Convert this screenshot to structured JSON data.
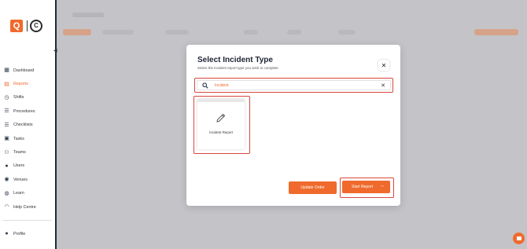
{
  "sidebar": {
    "items": [
      {
        "label": "Dashboard",
        "icon": "dashboard-icon",
        "glyph": "▦"
      },
      {
        "label": "Reports",
        "icon": "reports-icon",
        "glyph": "▤",
        "active": true
      },
      {
        "label": "Shifts",
        "icon": "clock-icon",
        "glyph": "◷"
      },
      {
        "label": "Procedures",
        "icon": "list-icon",
        "glyph": "☰"
      },
      {
        "label": "Checklists",
        "icon": "checklist-icon",
        "glyph": "☰"
      },
      {
        "label": "Tasks",
        "icon": "tasks-icon",
        "glyph": "▣"
      },
      {
        "label": "Teams",
        "icon": "teams-icon",
        "glyph": "⚇"
      },
      {
        "label": "Users",
        "icon": "user-icon",
        "glyph": "●"
      },
      {
        "label": "Venues",
        "icon": "location-pin-icon",
        "glyph": "◉"
      },
      {
        "label": "Learn",
        "icon": "lightbulb-icon",
        "glyph": "◍"
      },
      {
        "label": "Help Centre",
        "icon": "headset-icon",
        "glyph": "◠"
      }
    ],
    "bottom_items": [
      {
        "label": "Profile",
        "icon": "profile-icon",
        "glyph": "●"
      }
    ],
    "accent": "#ef6a2c"
  },
  "modal": {
    "title": "Select Incident Type",
    "subtitle": "Select the incident report type you wish to complete",
    "search": {
      "value": "Incident"
    },
    "cards": [
      {
        "label": "Incident Report",
        "icon": "pencil-icon"
      }
    ],
    "update_order_label": "Update Order",
    "start_report_label": "Start Report"
  },
  "colors": {
    "accent": "#ef6a2c",
    "highlight": "#d9473f",
    "overlay": "#c4c4c8"
  }
}
